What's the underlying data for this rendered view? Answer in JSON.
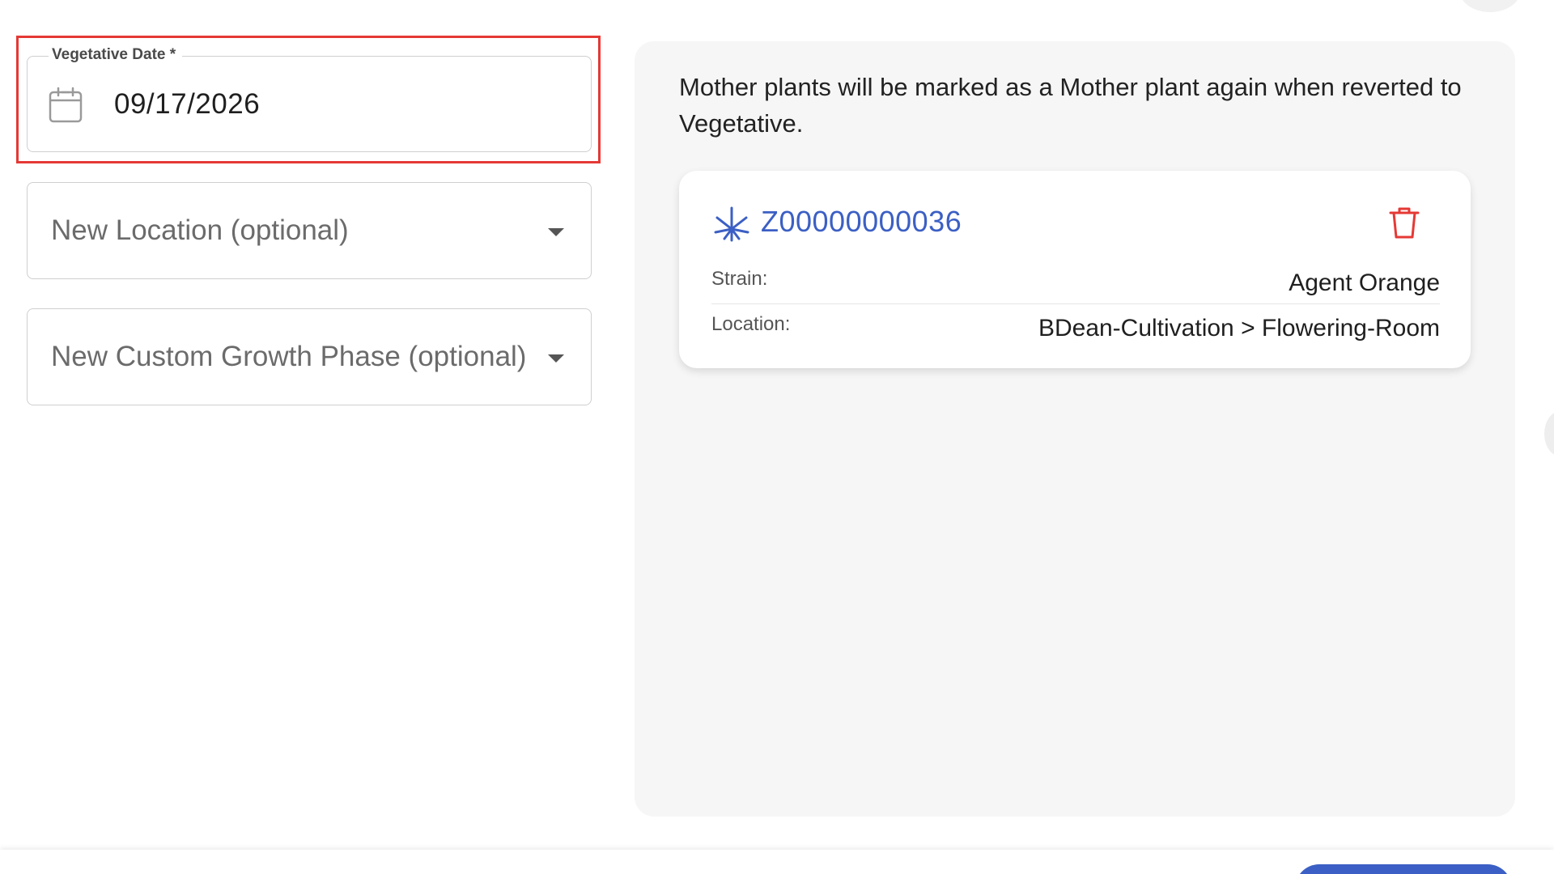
{
  "form": {
    "vegetative_date": {
      "label": "Vegetative Date *",
      "value": "09/17/2026",
      "icon": "calendar-icon"
    },
    "new_location": {
      "placeholder": "New Location (optional)",
      "icon": "caret-down-icon"
    },
    "new_growth_phase": {
      "placeholder": "New Custom Growth Phase (optional)",
      "icon": "caret-down-icon"
    }
  },
  "panel": {
    "note": "Mother plants will be marked as a Mother plant again when reverted to Vegetative.",
    "plants": [
      {
        "id": "Z00000000036",
        "icon": "cannabis-leaf-icon",
        "strain_label": "Strain:",
        "strain": "Agent Orange",
        "location_label": "Location:",
        "location": "BDean-Cultivation > Flowering-Room",
        "remove_icon": "trash-icon"
      }
    ]
  },
  "colors": {
    "accent": "#3b5fc4",
    "danger": "#e53935",
    "panel_bg": "#f6f6f6"
  }
}
